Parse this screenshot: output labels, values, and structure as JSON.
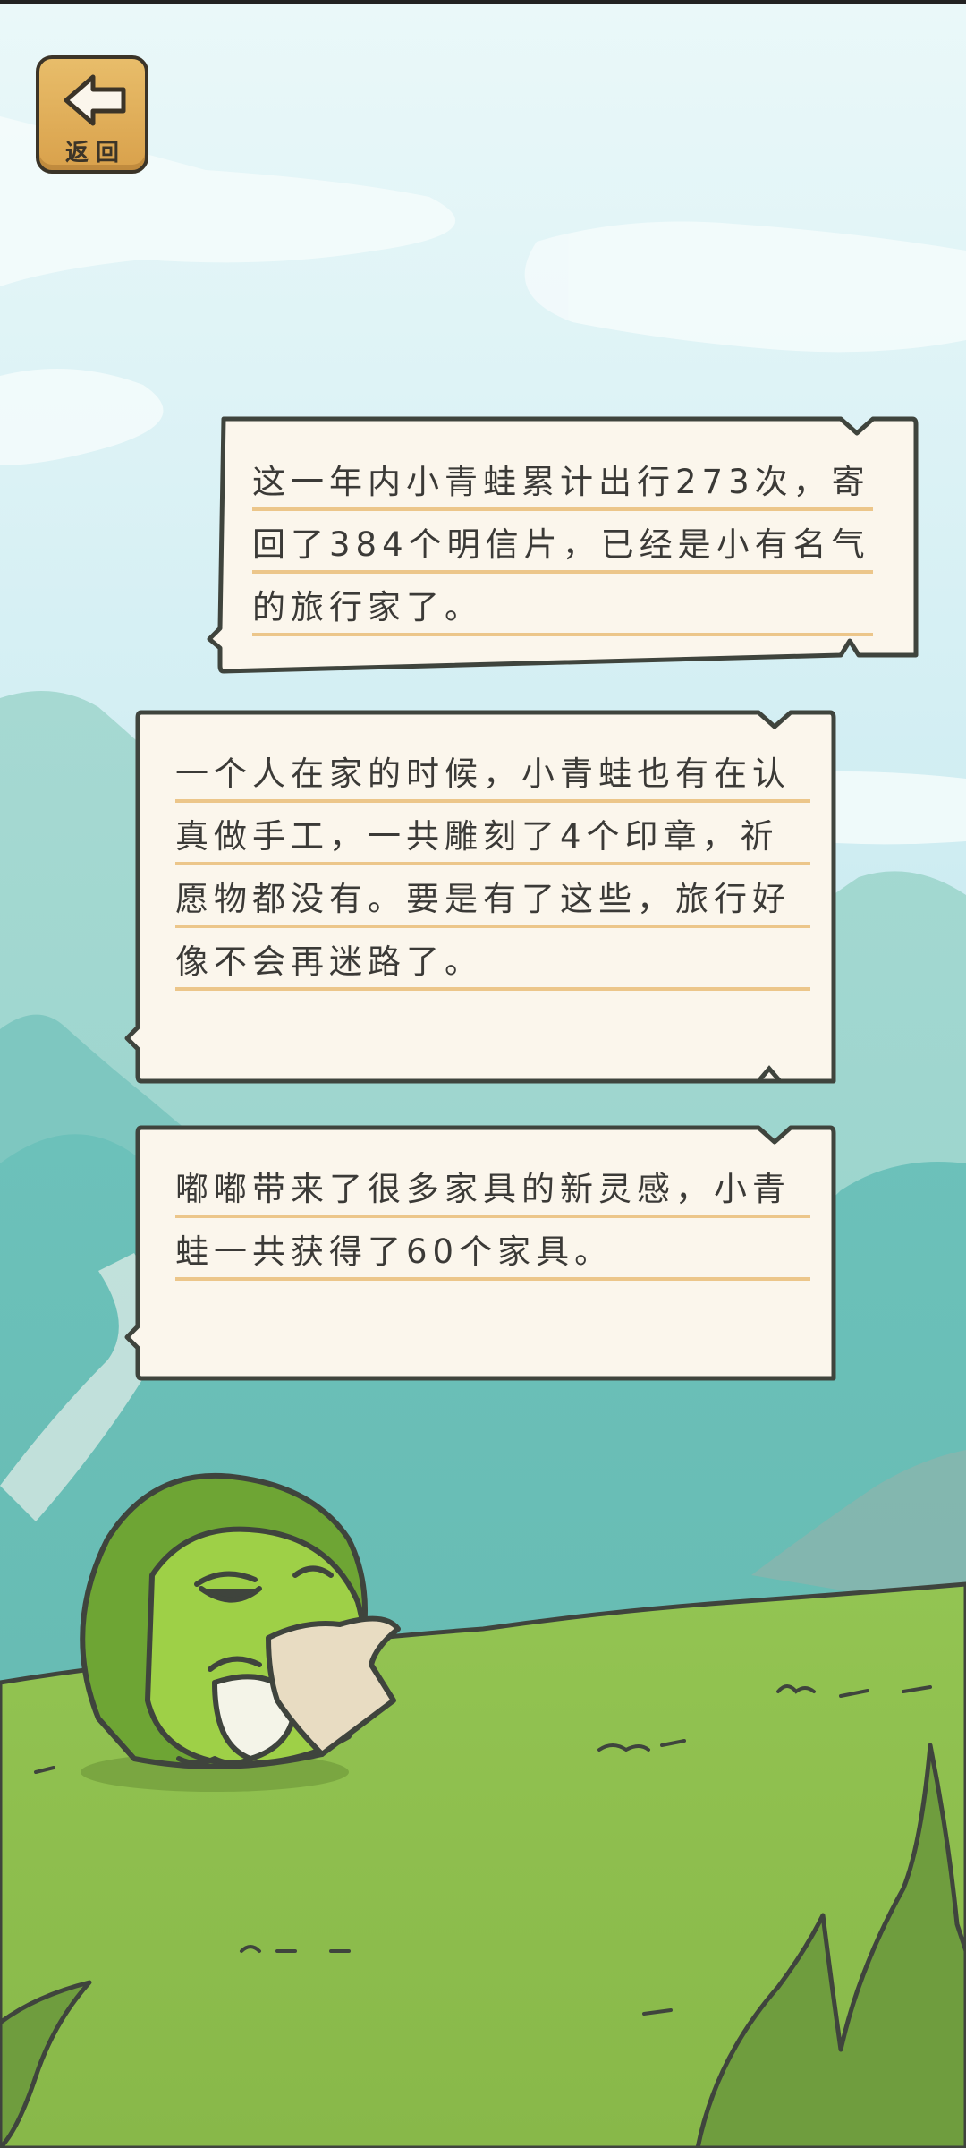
{
  "back_button": {
    "label": "返回",
    "icon": "back-arrow-icon"
  },
  "notes": [
    {
      "text": "这一年内小青蛙累计出行273次，寄回了384个明信片，已经是小有名气的旅行家了。"
    },
    {
      "text": "一个人在家的时候，小青蛙也有在认真做手工，一共雕刻了4个印章，祈愿物都没有。要是有了这些，旅行好像不会再迷路了。"
    },
    {
      "text": "嘟嘟带来了很多家具的新灵感，小青蛙一共获得了60个家具。"
    }
  ],
  "colors": {
    "sky_top": "#e6f6f8",
    "sky_bottom": "#bfe6ee",
    "mountain": "#7ecbc4",
    "grass": "#8fc04f",
    "paper": "#fbf6ec",
    "paper_border": "#3f443d",
    "rule_line": "#ecc68a",
    "frog_green": "#8cc63f"
  }
}
